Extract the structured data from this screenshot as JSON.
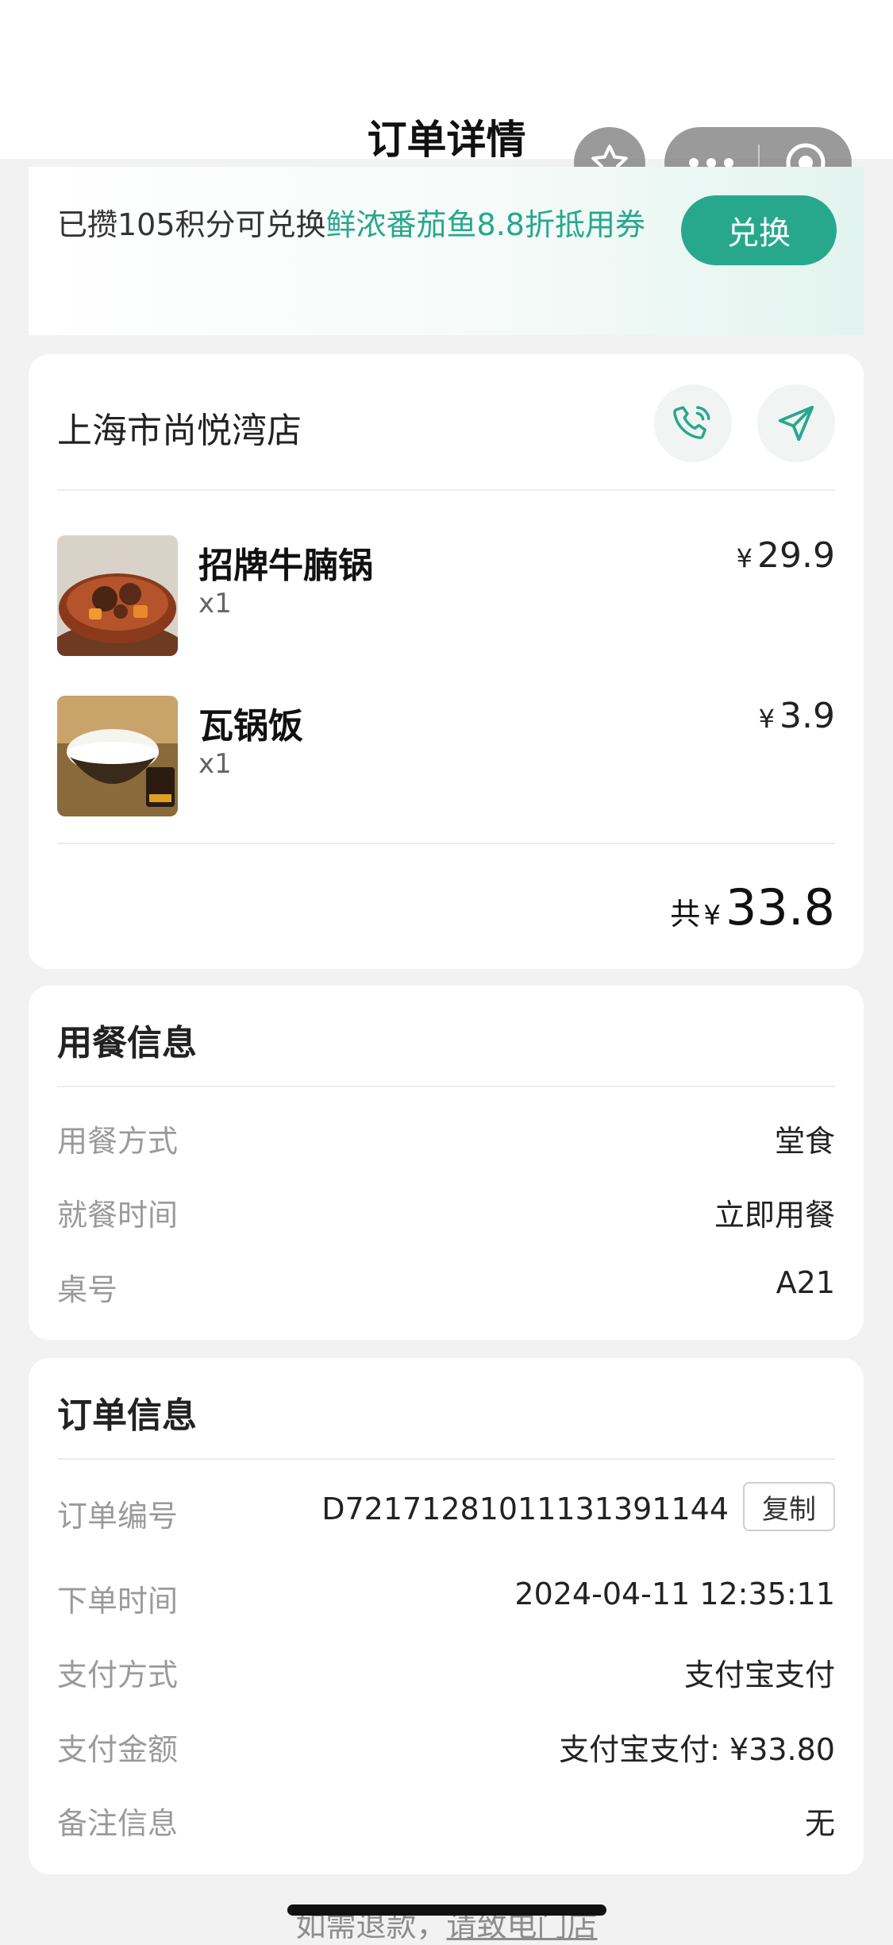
{
  "header": {
    "title": "订单详情"
  },
  "banner": {
    "text_prefix": "已攒105积分可兑换",
    "text_highlight": "鲜浓番茄鱼8.8折抵用券",
    "button_label": "兑换",
    "accent_color": "#27a88d"
  },
  "store": {
    "name": "上海市尚悦湾店",
    "call_icon": "phone-icon",
    "nav_icon": "navigation-icon"
  },
  "items": [
    {
      "name": "招牌牛腩锅",
      "qty": "x1",
      "currency": "¥",
      "price": "29.9"
    },
    {
      "name": "瓦锅饭",
      "qty": "x1",
      "currency": "¥",
      "price": "3.9"
    }
  ],
  "total": {
    "label": "共",
    "currency": "¥",
    "amount": "33.8"
  },
  "dining": {
    "title": "用餐信息",
    "rows": [
      {
        "key": "用餐方式",
        "value": "堂食"
      },
      {
        "key": "就餐时间",
        "value": "立即用餐"
      },
      {
        "key": "桌号",
        "value": "A21"
      }
    ]
  },
  "order": {
    "title": "订单信息",
    "order_no_label": "订单编号",
    "order_no": "D72171281011131391144",
    "copy_label": "复制",
    "rows": [
      {
        "key": "下单时间",
        "value": "2024-04-11 12:35:11"
      },
      {
        "key": "支付方式",
        "value": "支付宝支付"
      },
      {
        "key": "支付金额",
        "value": "支付宝支付: ¥33.80"
      },
      {
        "key": "备注信息",
        "value": "无"
      }
    ]
  },
  "footer": {
    "note_prefix": "如需退款，",
    "note_link": "请致电门店"
  }
}
